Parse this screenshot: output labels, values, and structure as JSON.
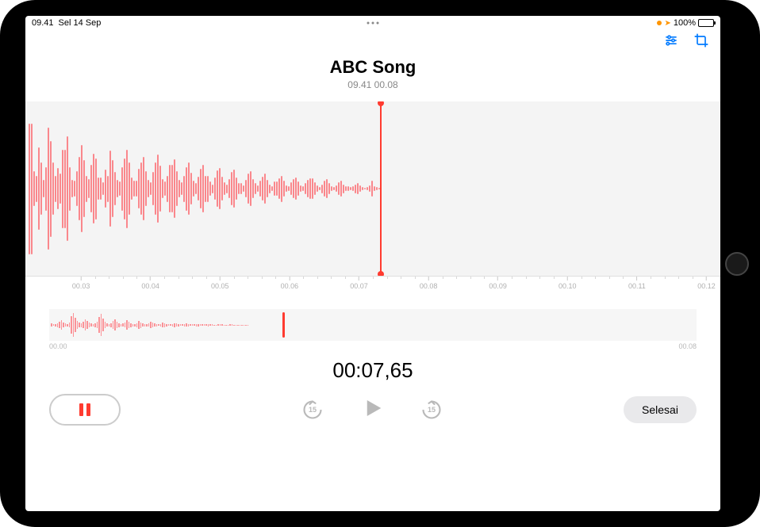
{
  "status": {
    "time": "09.41",
    "date": "Sel 14 Sep",
    "battery_pct": "100%",
    "orange_dot": true,
    "location_active": true
  },
  "toolbar": {
    "settings_icon": "settings-sliders-icon",
    "crop_icon": "crop-icon"
  },
  "header": {
    "title": "ABC Song",
    "subtitle": "09.41  00.08"
  },
  "waveform": {
    "playhead_pct": 51,
    "segments": [
      150,
      40,
      30,
      95,
      60,
      20,
      50,
      140,
      110,
      60,
      30,
      48,
      35,
      90,
      120,
      50,
      20,
      18,
      40,
      72,
      100,
      65,
      30,
      22,
      55,
      80,
      70,
      25,
      15,
      44,
      30,
      88,
      66,
      38,
      20,
      16,
      50,
      70,
      90,
      60,
      25,
      18,
      45,
      60,
      72,
      40,
      20,
      14,
      38,
      60,
      78,
      52,
      22,
      16,
      30,
      55,
      68,
      40,
      20,
      14,
      30,
      50,
      60,
      36,
      18,
      12,
      28,
      46,
      55,
      30,
      16,
      10,
      26,
      42,
      48,
      28,
      14,
      10,
      22,
      38,
      44,
      26,
      12,
      8,
      20,
      34,
      40,
      22,
      12,
      8,
      18,
      28,
      34,
      20,
      10,
      6,
      16,
      24,
      30,
      18,
      8,
      6,
      14,
      22,
      26,
      16,
      8,
      6,
      12,
      20,
      24,
      14,
      8,
      4,
      10,
      18,
      22,
      12,
      6,
      4,
      8,
      14,
      18,
      10,
      6,
      4,
      6,
      10,
      12,
      8,
      4,
      2,
      4,
      8,
      18,
      6,
      4,
      2
    ]
  },
  "ruler": {
    "labels": [
      "00.03",
      "00.04",
      "00.05",
      "00.06",
      "00.07",
      "00.08",
      "00.09",
      "00.10",
      "00.11",
      "00.12"
    ],
    "label_positions_pct": [
      8,
      18,
      28,
      38,
      48,
      58,
      68,
      78,
      88,
      98
    ]
  },
  "overview": {
    "start_label": "00.00",
    "end_label": "00.08",
    "playhead_pct": 36,
    "segments": [
      4,
      2,
      3,
      5,
      8,
      12,
      6,
      4,
      3,
      6,
      22,
      30,
      18,
      10,
      6,
      5,
      8,
      14,
      10,
      6,
      4,
      3,
      5,
      8,
      20,
      28,
      16,
      8,
      4,
      3,
      5,
      10,
      14,
      8,
      5,
      3,
      4,
      6,
      12,
      8,
      5,
      3,
      3,
      5,
      10,
      7,
      4,
      3,
      3,
      4,
      8,
      6,
      4,
      3,
      2,
      3,
      6,
      5,
      3,
      2,
      2,
      3,
      5,
      4,
      3,
      2,
      2,
      3,
      4,
      3,
      2,
      2,
      2,
      3,
      3,
      2,
      2,
      2,
      2,
      3,
      2,
      2,
      1,
      1,
      2,
      2,
      2,
      1,
      1,
      1,
      2,
      2,
      1,
      1,
      1,
      1,
      1,
      1,
      1,
      1
    ]
  },
  "timecode": "00:07,65",
  "controls": {
    "pause_label": "pause",
    "skip_back_seconds": "15",
    "skip_forward_seconds": "15",
    "play_label": "play",
    "done_label": "Selesai"
  },
  "colors": {
    "accent_red": "#ff3b30",
    "ios_blue": "#007aff"
  }
}
